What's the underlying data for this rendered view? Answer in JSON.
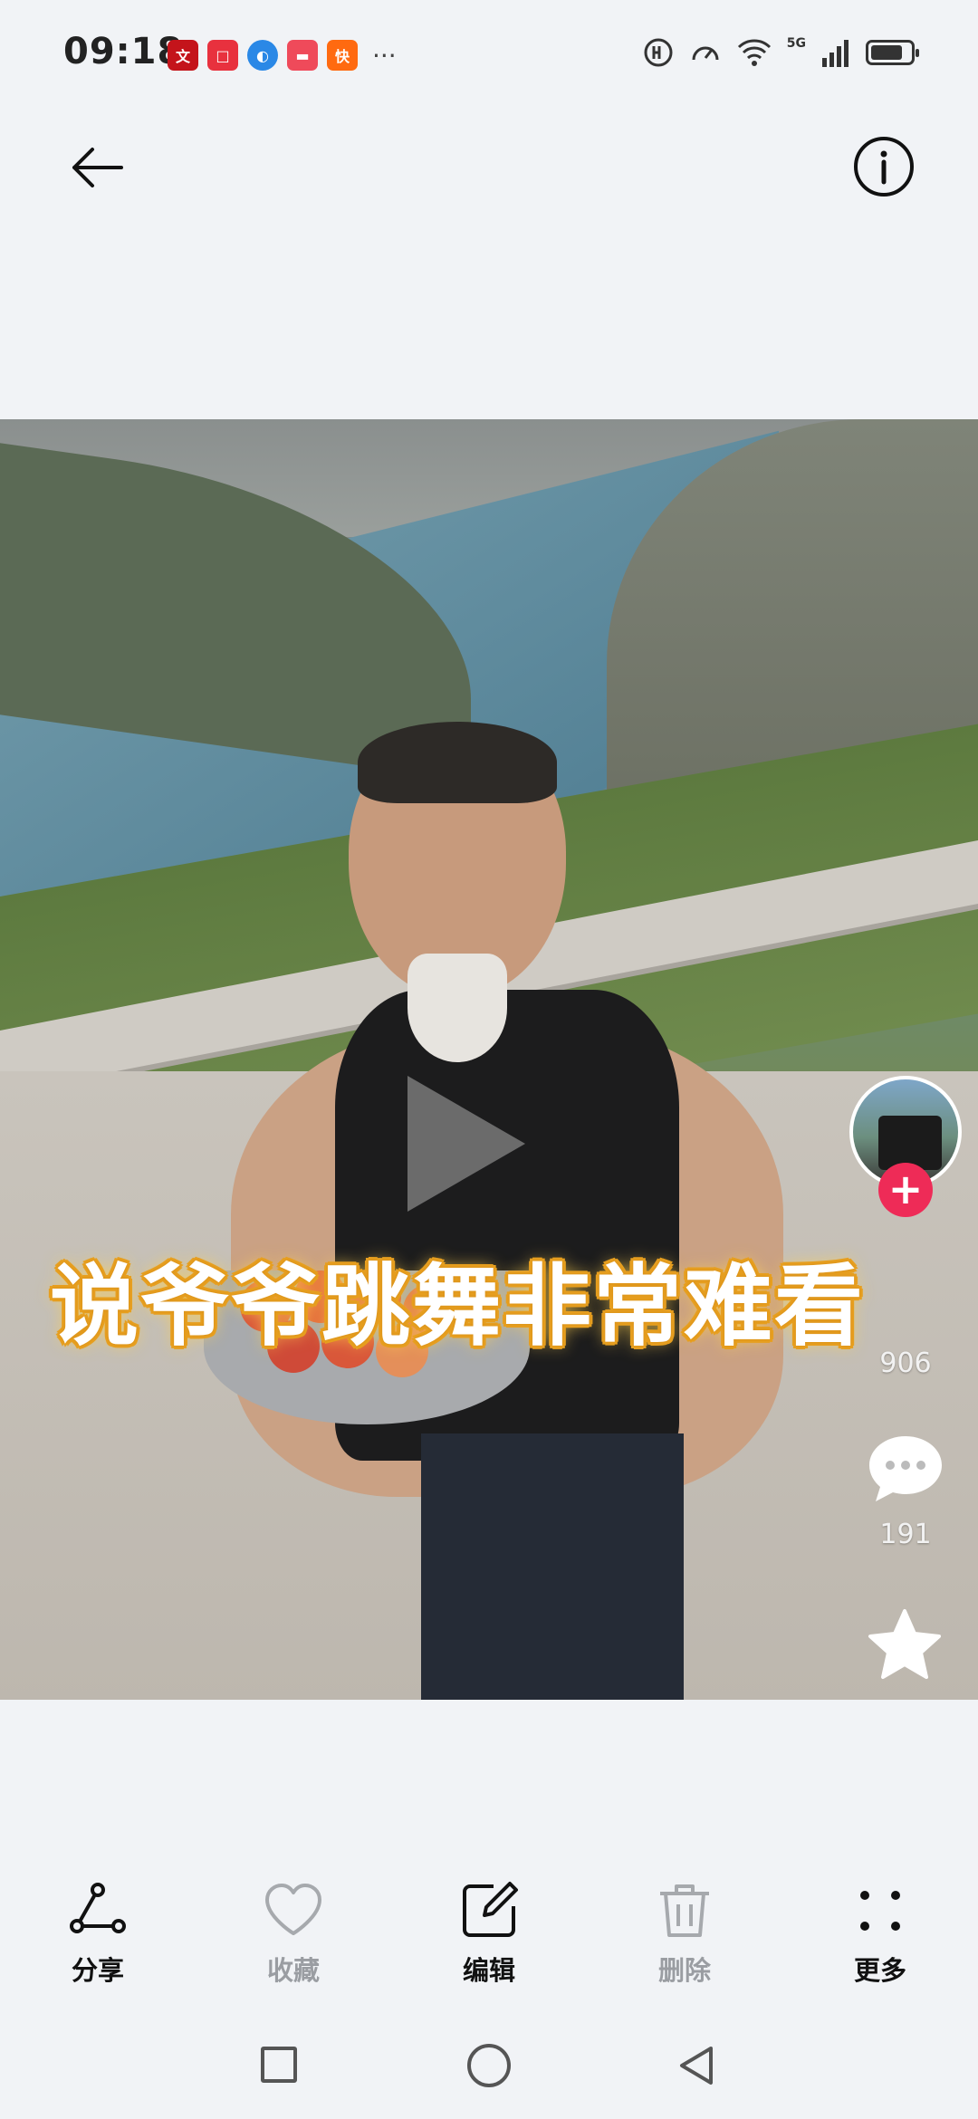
{
  "status_bar": {
    "time": "09:18",
    "overflow": "···",
    "network": "5G",
    "notification_colors": [
      "#c4141b",
      "#e8313e",
      "#2a88e6",
      "#ef4a5a",
      "#ff6a10"
    ]
  },
  "video": {
    "caption": "说爷爷跳舞非常难看",
    "likes": "906",
    "comments": "191",
    "follow_symbol": "+",
    "accent": "#ee2b57"
  },
  "actions": [
    {
      "label": "分享",
      "icon": "share-icon",
      "enabled": true
    },
    {
      "label": "收藏",
      "icon": "heart-icon",
      "enabled": false
    },
    {
      "label": "编辑",
      "icon": "edit-icon",
      "enabled": true
    },
    {
      "label": "删除",
      "icon": "trash-icon",
      "enabled": false
    },
    {
      "label": "更多",
      "icon": "more-icon",
      "enabled": true
    }
  ]
}
